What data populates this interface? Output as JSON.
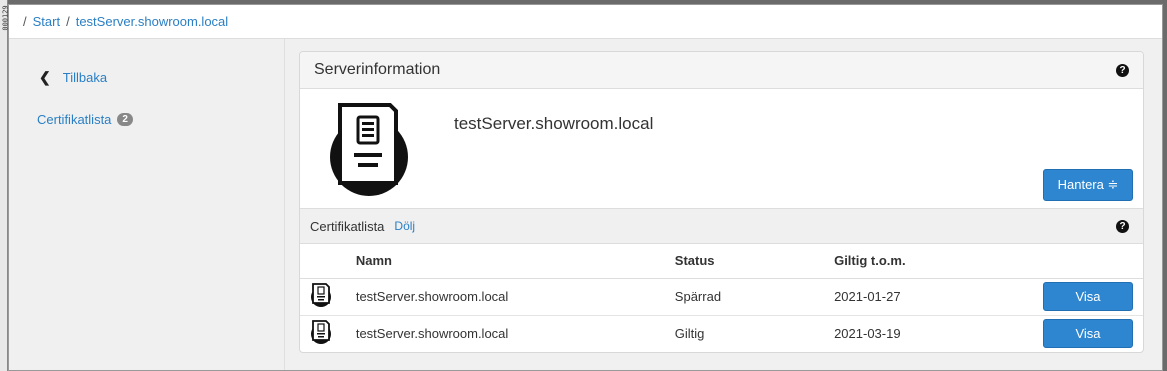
{
  "side_label": "000129",
  "breadcrumb": {
    "start": "Start",
    "current": "testServer.showroom.local"
  },
  "sidebar": {
    "back_label": "Tillbaka",
    "cert_list_label": "Certifikatlista",
    "cert_count": "2"
  },
  "server_panel": {
    "title": "Serverinformation",
    "help": "?",
    "server_name": "testServer.showroom.local",
    "manage_label": "Hantera ≑"
  },
  "cert_panel": {
    "title": "Certifikatlista",
    "hide_label": "Dölj",
    "help": "?",
    "columns": {
      "name": "Namn",
      "status": "Status",
      "valid": "Giltig t.o.m."
    },
    "rows": [
      {
        "name": "testServer.showroom.local",
        "status": "Spärrad",
        "valid": "2021-01-27",
        "action": "Visa"
      },
      {
        "name": "testServer.showroom.local",
        "status": "Giltig",
        "valid": "2021-03-19",
        "action": "Visa"
      }
    ]
  },
  "colors": {
    "accent": "#2e86d0",
    "link": "#2a7fc4"
  }
}
